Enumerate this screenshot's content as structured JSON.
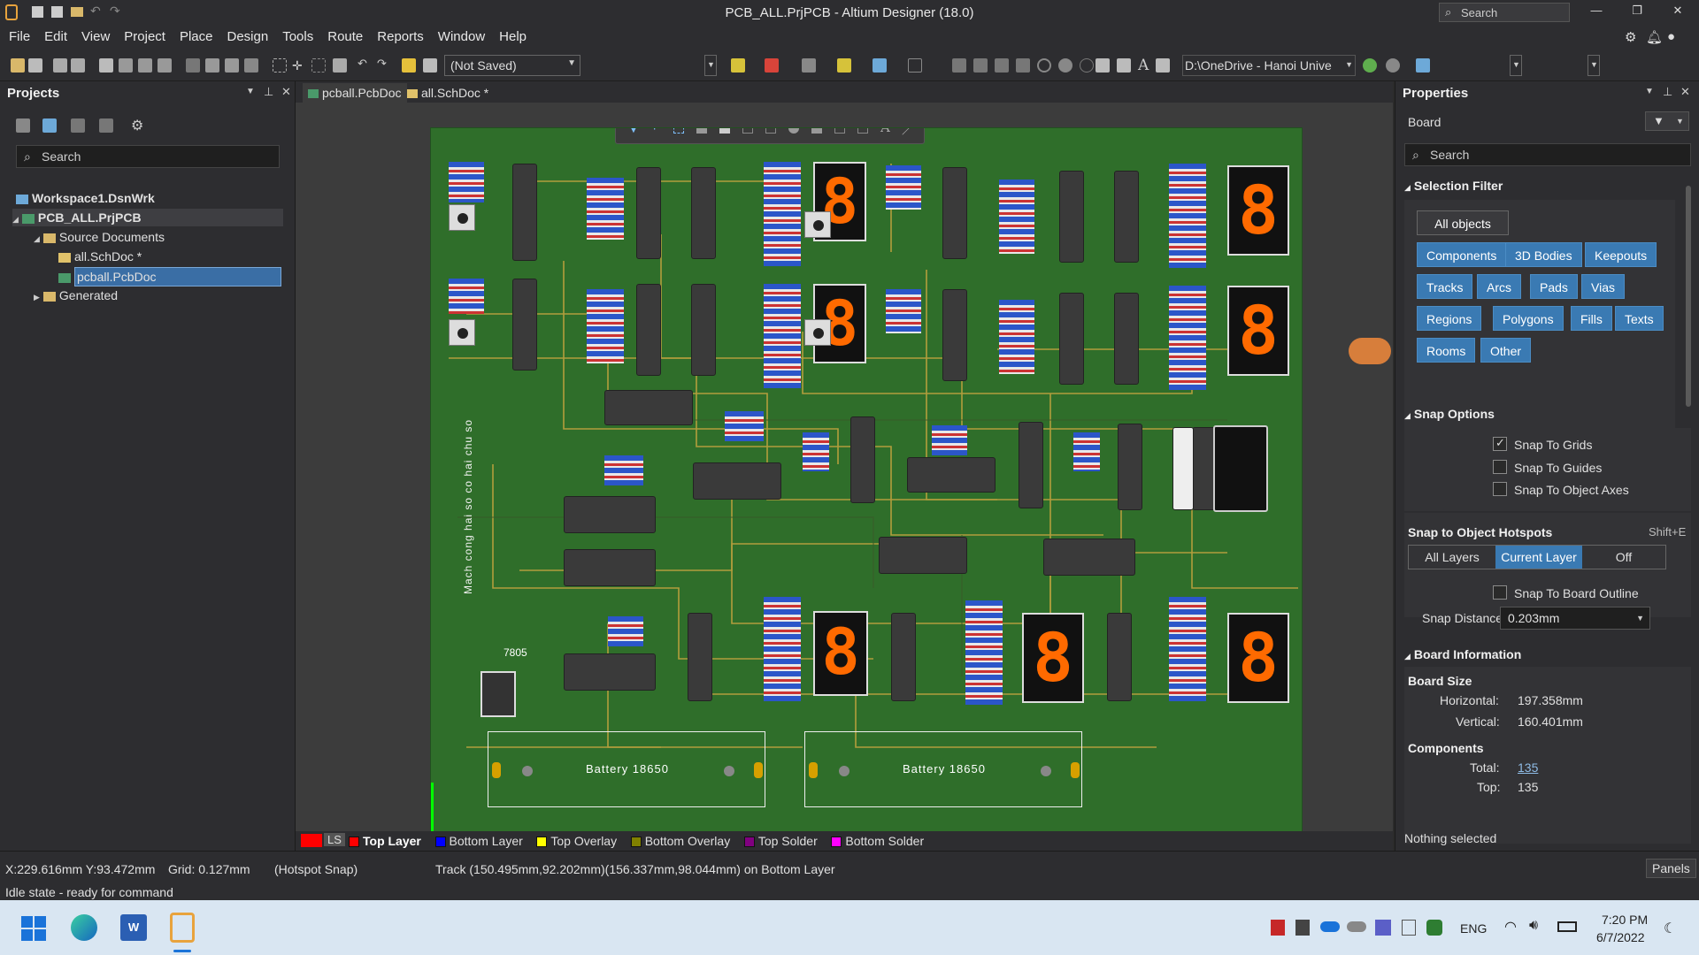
{
  "title": "PCB_ALL.PrjPCB - Altium Designer (18.0)",
  "title_search": "Search",
  "menu": [
    "File",
    "Edit",
    "View",
    "Project",
    "Place",
    "Design",
    "Tools",
    "Route",
    "Reports",
    "Window",
    "Help"
  ],
  "toolbar": {
    "not_saved": "(Not Saved)",
    "path": "D:\\OneDrive - Hanoi Unive"
  },
  "projects": {
    "title": "Projects",
    "search_placeholder": "Search",
    "tree": {
      "workspace": "Workspace1.DsnWrk",
      "project": "PCB_ALL.PrjPCB",
      "source_docs": "Source Documents",
      "schdoc": "all.SchDoc *",
      "pcbdoc": "pcball.PcbDoc",
      "generated": "Generated"
    }
  },
  "tabs": [
    "pcball.PcbDoc",
    "all.SchDoc *"
  ],
  "pcb": {
    "silk_text": "Mach cong hai so co hai chu so",
    "reg_label": "7805",
    "battery_labels": [
      "Battery 18650",
      "Battery 18650"
    ]
  },
  "layers": {
    "ls": "LS",
    "items": [
      {
        "name": "Top Layer",
        "color": "#ff0000"
      },
      {
        "name": "Bottom Layer",
        "color": "#0000ff"
      },
      {
        "name": "Top Overlay",
        "color": "#ffff00"
      },
      {
        "name": "Bottom Overlay",
        "color": "#808000"
      },
      {
        "name": "Top Solder",
        "color": "#800080"
      },
      {
        "name": "Bottom Solder",
        "color": "#ff00ff"
      }
    ]
  },
  "properties": {
    "title": "Properties",
    "board": "Board",
    "search_placeholder": "Search",
    "selection_filter": "Selection Filter",
    "all_objects": "All objects",
    "filters": [
      "Components",
      "3D Bodies",
      "Keepouts",
      "Tracks",
      "Arcs",
      "Pads",
      "Vias",
      "Regions",
      "Polygons",
      "Fills",
      "Texts",
      "Rooms",
      "Other"
    ],
    "snap_options": "Snap Options",
    "snap_checks": [
      {
        "label": "Snap To Grids",
        "checked": true
      },
      {
        "label": "Snap To Guides",
        "checked": false
      },
      {
        "label": "Snap To Object Axes",
        "checked": false
      }
    ],
    "hotspots_title": "Snap to Object Hotspots",
    "hotspots_shortcut": "Shift+E",
    "hotspot_options": [
      "All Layers",
      "Current Layer",
      "Off"
    ],
    "snap_board_outline": "Snap To Board Outline",
    "snap_distance_label": "Snap Distance",
    "snap_distance_value": "0.203mm",
    "board_info": "Board Information",
    "board_size": "Board Size",
    "horizontal_label": "Horizontal:",
    "horizontal_value": "197.358mm",
    "vertical_label": "Vertical:",
    "vertical_value": "160.401mm",
    "components": "Components",
    "total_label": "Total:",
    "total_value": "135",
    "top_label": "Top:",
    "top_value": "135",
    "nothing_selected": "Nothing selected"
  },
  "status": {
    "coords": "X:229.616mm Y:93.472mm",
    "grid": "Grid: 0.127mm",
    "snap": "(Hotspot Snap)",
    "track": "Track (150.495mm,92.202mm)(156.337mm,98.044mm) on Bottom Layer",
    "idle": "Idle state - ready for command",
    "panels": "Panels"
  },
  "taskbar": {
    "lang": "ENG",
    "time": "7:20 PM",
    "date": "6/7/2022"
  }
}
